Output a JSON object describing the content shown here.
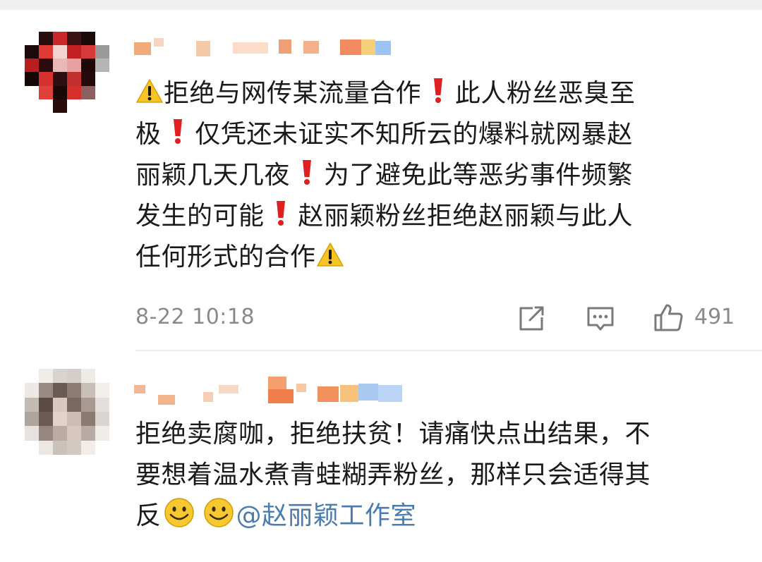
{
  "comments": [
    {
      "nickname": "",
      "lines": [
        "拒绝与网传某流量合作",
        "此人粉丝恶臭至",
        "极",
        "仅凭还未证实不知所云的爆料就网暴赵",
        "丽颖几天几夜",
        "为了避免此等恶劣事件频繁",
        "发生的可能",
        "赵丽颖粉丝拒绝赵丽颖与此人",
        "任何形式的合作"
      ],
      "time": "8-22 10:18",
      "likes": "491",
      "icons": [
        "warning-emoji",
        "exclamation-emoji",
        "share-icon",
        "comment-icon",
        "thumbs-up-icon"
      ]
    },
    {
      "nickname": "",
      "lines": [
        "拒绝卖腐咖，拒绝扶贫！请痛快点出结果，不",
        "要想着温水煮青蛙糊弄粉丝，那样只会适得其",
        "反"
      ],
      "mention": "@赵丽颖工作室",
      "icons": [
        "smile-emoji",
        "smile-emoji"
      ]
    }
  ],
  "colors": {
    "mention": "#4a7cb0",
    "meta_text": "#8a8a8a",
    "exclamation": "#e02020",
    "warning": "#f7c427"
  }
}
